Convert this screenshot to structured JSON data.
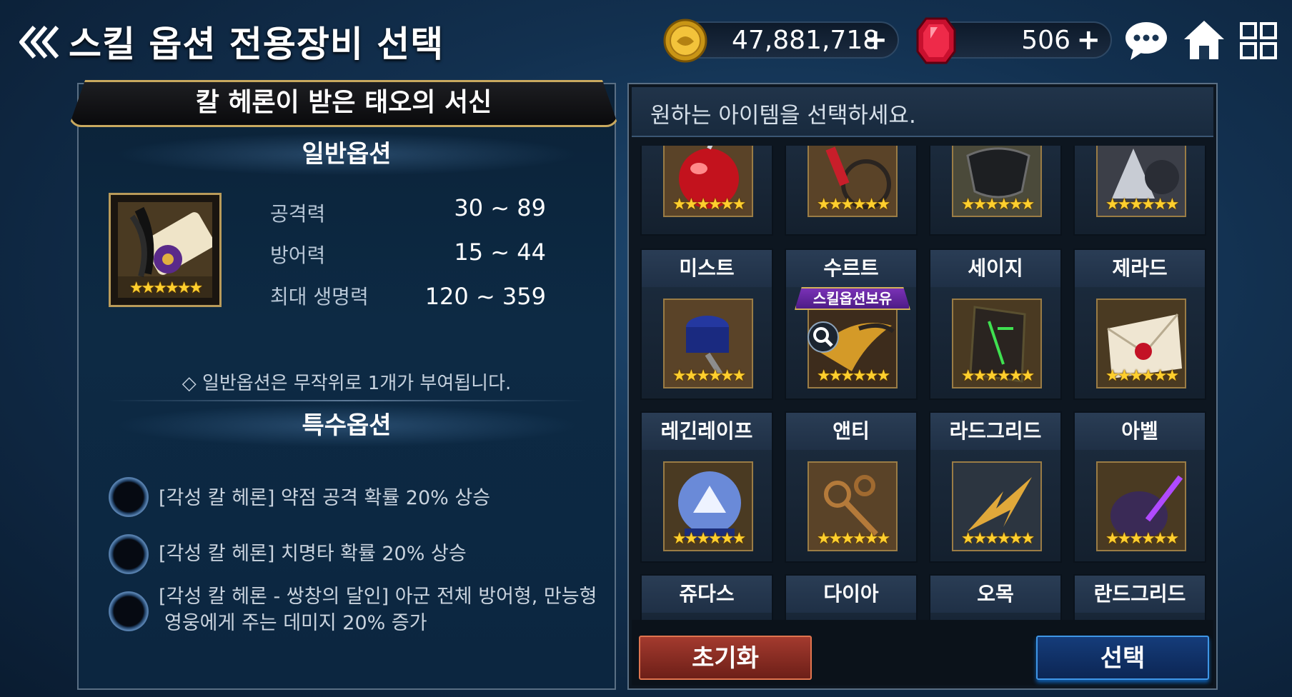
{
  "header": {
    "title": "스킬 옵션 전용장비 선택",
    "gold": "47,881,718",
    "gems": "506",
    "plus": "+"
  },
  "item_panel": {
    "title": "칼 헤론이 받은 태오의 서신",
    "general_section": "일반옵션",
    "stats": [
      {
        "name": "공격력",
        "value": "30 ~ 89"
      },
      {
        "name": "방어력",
        "value": "15 ~ 44"
      },
      {
        "name": "최대 생명력",
        "value": "120 ~ 359"
      }
    ],
    "item_stars": "★★★★★★",
    "note": "◇ 일반옵션은 무작위로 1개가 부여됩니다.",
    "special_section": "특수옵션",
    "special_options": [
      {
        "line1": "[각성 칼 헤론] 약점 공격 확률 20% 상승",
        "line2": ""
      },
      {
        "line1": "[각성 칼 헤론] 치명타 확률 20% 상승",
        "line2": ""
      },
      {
        "line1": "[각성 칼 헤론 - 쌍창의 달인] 아군 전체 방어형, 만능형",
        "line2": "영웅에게 주는 데미지 20% 증가"
      }
    ]
  },
  "selection_panel": {
    "prompt": "원하는 아이템을 선택하세요.",
    "stars": "★★★★★★",
    "skill_badge": "스킬옵션보유",
    "rows": [
      [
        {
          "name": ""
        },
        {
          "name": ""
        },
        {
          "name": ""
        },
        {
          "name": ""
        }
      ],
      [
        {
          "name": "미스트"
        },
        {
          "name": "수르트"
        },
        {
          "name": "세이지"
        },
        {
          "name": "제라드"
        }
      ],
      [
        {
          "name": "레긴레이프"
        },
        {
          "name": "앤티"
        },
        {
          "name": "라드그리드"
        },
        {
          "name": "아벨"
        }
      ],
      [
        {
          "name": "쥬다스"
        },
        {
          "name": "다이아"
        },
        {
          "name": "오목"
        },
        {
          "name": "란드그리드"
        }
      ]
    ],
    "reset_label": "초기화",
    "select_label": "선택"
  }
}
